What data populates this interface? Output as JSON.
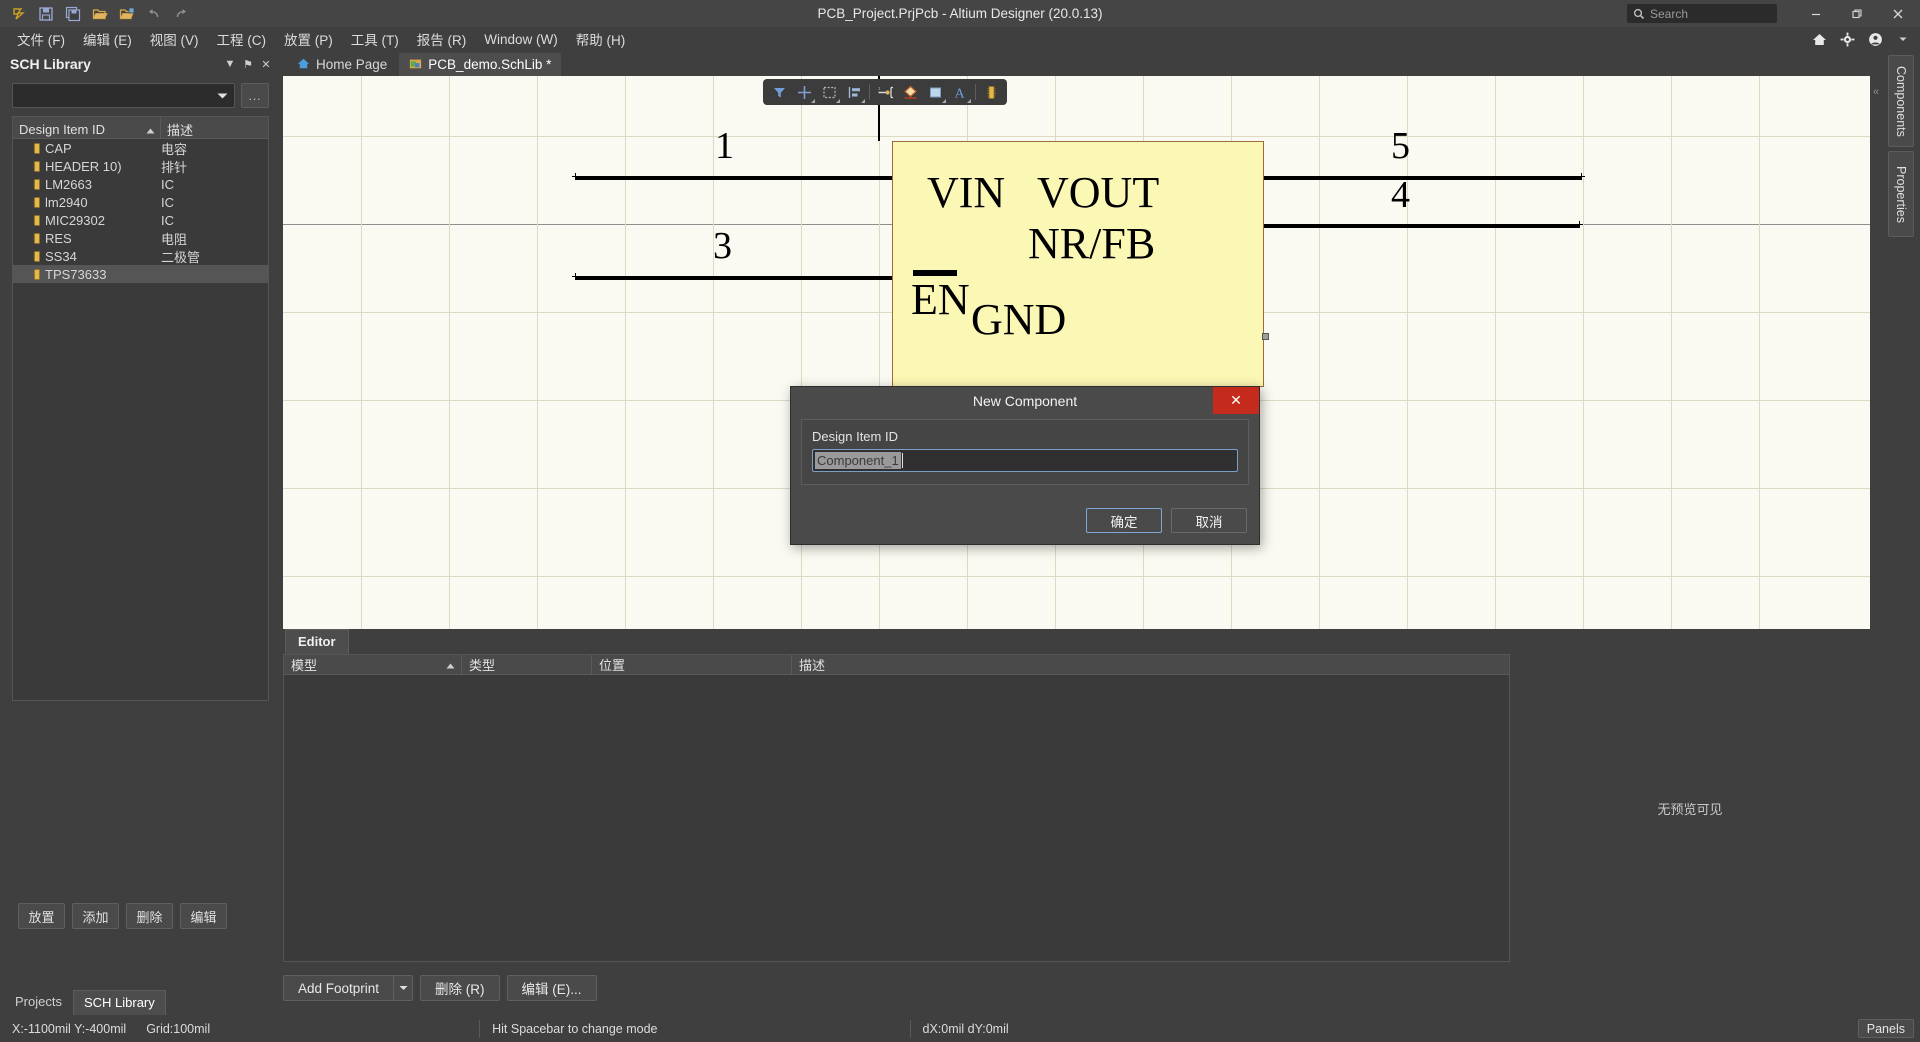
{
  "titlebar": {
    "title": "PCB_Project.PrjPcb - Altium Designer (20.0.13)",
    "quick_access": [
      {
        "name": "altium-logo-icon",
        "label": "Altium"
      },
      {
        "name": "save-icon",
        "label": "Save"
      },
      {
        "name": "save-all-icon",
        "label": "Save All"
      },
      {
        "name": "open-icon",
        "label": "Open"
      },
      {
        "name": "open-project-icon",
        "label": "Open Project"
      },
      {
        "name": "undo-icon",
        "label": "Undo"
      },
      {
        "name": "redo-icon",
        "label": "Redo"
      }
    ],
    "search_placeholder": "Search",
    "window_buttons": {
      "minimize": "—",
      "restore": "❐",
      "close": "✕"
    }
  },
  "menubar": {
    "items": [
      {
        "label": "文件 (F)",
        "accel": "F"
      },
      {
        "label": "编辑 (E)",
        "accel": "E"
      },
      {
        "label": "视图 (V)",
        "accel": "V"
      },
      {
        "label": "工程 (C)",
        "accel": "C"
      },
      {
        "label": "放置 (P)",
        "accel": "P"
      },
      {
        "label": "工具 (T)",
        "accel": "T"
      },
      {
        "label": "报告 (R)",
        "accel": "R"
      },
      {
        "label": "Window (W)",
        "accel": "W"
      },
      {
        "label": "帮助 (H)",
        "accel": "H"
      }
    ],
    "right_icons": [
      {
        "name": "home-icon"
      },
      {
        "name": "gear-icon"
      },
      {
        "name": "account-icon"
      },
      {
        "name": "chevron-down-icon"
      }
    ]
  },
  "sch_library_panel": {
    "title": "SCH Library",
    "header_buttons": [
      {
        "name": "panel-menu-icon",
        "glyph": "▼"
      },
      {
        "name": "pin-icon",
        "glyph": "⚑"
      },
      {
        "name": "close-icon",
        "glyph": "✕"
      }
    ],
    "filter_value": "",
    "ellipsis_label": "...",
    "columns": [
      {
        "key": "design_item_id",
        "label": "Design Item ID",
        "sort": "asc"
      },
      {
        "key": "description",
        "label": "描述"
      }
    ],
    "rows": [
      {
        "id": "CAP",
        "description": "电容",
        "selected": false
      },
      {
        "id": "HEADER 10)",
        "description": "排针",
        "selected": false
      },
      {
        "id": "LM2663",
        "description": "IC",
        "selected": false
      },
      {
        "id": "lm2940",
        "description": "IC",
        "selected": false
      },
      {
        "id": "MIC29302",
        "description": "IC",
        "selected": false
      },
      {
        "id": "RES",
        "description": "电阻",
        "selected": false
      },
      {
        "id": "SS34",
        "description": "二极管",
        "selected": false
      },
      {
        "id": "TPS73633",
        "description": "",
        "selected": true
      }
    ],
    "buttons": [
      {
        "name": "place-button",
        "label": "放置"
      },
      {
        "name": "add-button",
        "label": "添加"
      },
      {
        "name": "delete-button",
        "label": "删除"
      },
      {
        "name": "edit-button",
        "label": "编辑"
      }
    ]
  },
  "left_tabs": [
    {
      "name": "tab-projects",
      "label": "Projects",
      "active": false
    },
    {
      "name": "tab-sch-library",
      "label": "SCH Library",
      "active": true
    }
  ],
  "editor_tabs": [
    {
      "name": "tab-home-page",
      "label": "Home Page",
      "icon": "home-icon",
      "active": false
    },
    {
      "name": "tab-pcb-demo-schlib",
      "label": "PCB_demo.SchLib *",
      "icon": "schlib-icon",
      "active": true
    }
  ],
  "floating_toolbar": [
    {
      "name": "filter-icon",
      "dropdown": false
    },
    {
      "name": "crosshair-icon",
      "dropdown": true
    },
    {
      "name": "selection-rectangle-icon",
      "dropdown": true
    },
    {
      "name": "align-icon",
      "dropdown": true
    },
    {
      "name": "place-pin-icon",
      "dropdown": false
    },
    {
      "name": "place-polygon-icon",
      "dropdown": false
    },
    {
      "name": "place-rectangle-icon",
      "dropdown": true
    },
    {
      "name": "place-text-icon",
      "dropdown": true
    },
    {
      "name": "component-icon",
      "dropdown": false
    }
  ],
  "schematic": {
    "body_color": "#fbf7b5",
    "border_color": "#9e6a3a",
    "canvas_color": "#fbfaf2",
    "pin_labels_left": [
      "VIN",
      "EN"
    ],
    "pin_labels_right": [
      "VOUT",
      "NR/FB",
      "GND"
    ],
    "pins": [
      {
        "number": "1",
        "name": "VIN",
        "side": "left"
      },
      {
        "number": "3",
        "name": "EN",
        "side": "left"
      },
      {
        "number": "5",
        "name": "VOUT",
        "side": "right"
      },
      {
        "number": "4",
        "name": "NR/FB",
        "side": "right"
      }
    ]
  },
  "editor_subtab": {
    "label": "Editor"
  },
  "model_table": {
    "columns": [
      {
        "key": "model",
        "label": "模型",
        "sort": "asc"
      },
      {
        "key": "type",
        "label": "类型"
      },
      {
        "key": "location",
        "label": "位置"
      },
      {
        "key": "description",
        "label": "描述"
      }
    ],
    "rows": []
  },
  "preview": {
    "empty_text": "无预览可见"
  },
  "model_buttons": [
    {
      "name": "add-footprint-button",
      "label": "Add Footprint",
      "has_dropdown": true
    },
    {
      "name": "delete-model-button",
      "label": "删除 (R)"
    },
    {
      "name": "edit-model-button",
      "label": "编辑 (E)..."
    }
  ],
  "right_panels": [
    {
      "name": "vtab-components",
      "label": "Components"
    },
    {
      "name": "vtab-properties",
      "label": "Properties"
    }
  ],
  "statusbar": {
    "coordinates": "X:-1100mil Y:-400mil",
    "grid": "Grid:100mil",
    "hint": "Hit Spacebar to change mode",
    "delta": "dX:0mil dY:0mil",
    "panels_label": "Panels"
  },
  "dialog": {
    "title": "New Component",
    "close_glyph": "✕",
    "field_label": "Design Item ID",
    "field_value": "Component_1",
    "ok_label": "确定",
    "cancel_label": "取消"
  }
}
